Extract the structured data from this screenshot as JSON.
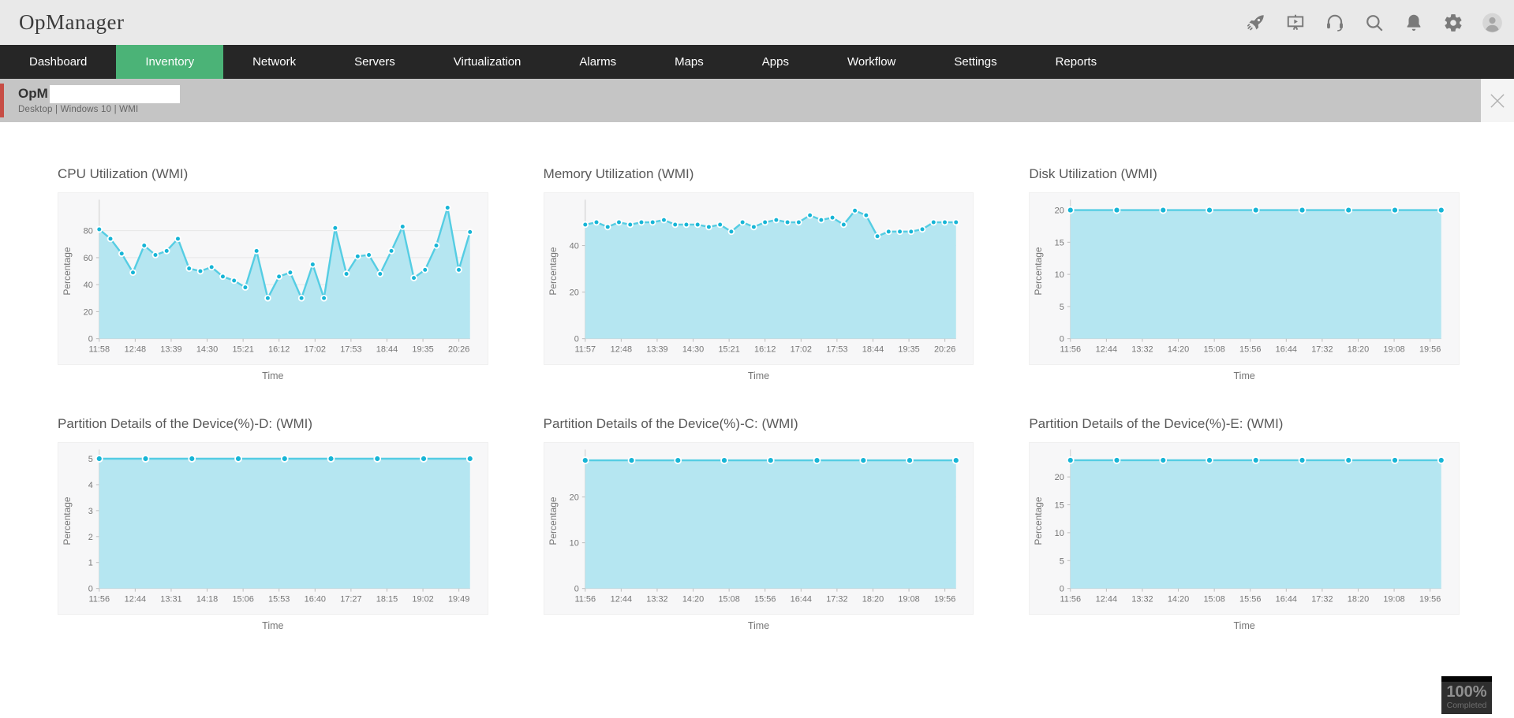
{
  "app": {
    "logo_text": "OpManager"
  },
  "topbar": {
    "icons": [
      "rocket",
      "presentation",
      "headset",
      "search",
      "notifications",
      "settings",
      "user-avatar"
    ]
  },
  "nav": {
    "items": [
      {
        "label": "Dashboard",
        "active": false
      },
      {
        "label": "Inventory",
        "active": true
      },
      {
        "label": "Network",
        "active": false
      },
      {
        "label": "Servers",
        "active": false
      },
      {
        "label": "Virtualization",
        "active": false
      },
      {
        "label": "Alarms",
        "active": false
      },
      {
        "label": "Maps",
        "active": false
      },
      {
        "label": "Apps",
        "active": false
      },
      {
        "label": "Workflow",
        "active": false
      },
      {
        "label": "Settings",
        "active": false
      },
      {
        "label": "Reports",
        "active": false
      }
    ]
  },
  "device_bar": {
    "name_visible": "OpM",
    "subtitle": "Desktop | Windows 10  | WMI"
  },
  "progress": {
    "percent": "100%",
    "label": "Completed"
  },
  "colors": {
    "accent_green": "#4bb377",
    "accent_red": "#c74d45",
    "area_fill": "#b5e6f1",
    "line": "#55cde3",
    "marker": "#17b5d6"
  },
  "chart_data": [
    {
      "id": "cpu",
      "type": "area",
      "title": "CPU Utilization (WMI)",
      "ylabel": "Percentage",
      "xlabel": "Time",
      "yticks": [
        0,
        20,
        40,
        60,
        80
      ],
      "ymax": 100,
      "xtick_labels": [
        "11:58",
        "12:48",
        "13:39",
        "14:30",
        "15:21",
        "16:12",
        "17:02",
        "17:53",
        "18:44",
        "19:35",
        "20:26"
      ],
      "values": [
        81,
        74,
        63,
        49,
        69,
        62,
        65,
        74,
        52,
        50,
        53,
        46,
        43,
        38,
        65,
        30,
        46,
        49,
        30,
        55,
        30,
        82,
        48,
        61,
        62,
        48,
        65,
        83,
        45,
        51,
        69,
        97,
        51,
        79
      ]
    },
    {
      "id": "memory",
      "type": "area",
      "title": "Memory Utilization (WMI)",
      "ylabel": "Percentage",
      "xlabel": "Time",
      "yticks": [
        0,
        20,
        40
      ],
      "ymax": 58,
      "xtick_labels": [
        "11:57",
        "12:48",
        "13:39",
        "14:30",
        "15:21",
        "16:12",
        "17:02",
        "17:53",
        "18:44",
        "19:35",
        "20:26"
      ],
      "values": [
        49,
        50,
        48,
        50,
        49,
        50,
        50,
        51,
        49,
        49,
        49,
        48,
        49,
        46,
        50,
        48,
        50,
        51,
        50,
        50,
        53,
        51,
        52,
        49,
        55,
        53,
        44,
        46,
        46,
        46,
        47,
        50,
        50,
        50
      ]
    },
    {
      "id": "disk",
      "type": "area",
      "title": "Disk Utilization (WMI)",
      "ylabel": "Percentage",
      "xlabel": "Time",
      "yticks": [
        0,
        5,
        10,
        15,
        20
      ],
      "ymax": 21,
      "xtick_labels": [
        "11:56",
        "12:44",
        "13:32",
        "14:20",
        "15:08",
        "15:56",
        "16:44",
        "17:32",
        "18:20",
        "19:08",
        "19:56"
      ],
      "values": [
        20,
        20,
        20,
        20,
        20,
        20,
        20,
        20,
        20
      ]
    },
    {
      "id": "partition-d",
      "type": "area",
      "title": "Partition Details of the Device(%)-D: (WMI)",
      "ylabel": "Percentage",
      "xlabel": "Time",
      "yticks": [
        0,
        1,
        2,
        3,
        4,
        5
      ],
      "ymax": 5.2,
      "xtick_labels": [
        "11:56",
        "12:44",
        "13:31",
        "14:18",
        "15:06",
        "15:53",
        "16:40",
        "17:27",
        "18:15",
        "19:02",
        "19:49"
      ],
      "values": [
        5,
        5,
        5,
        5,
        5,
        5,
        5,
        5,
        5
      ]
    },
    {
      "id": "partition-c",
      "type": "area",
      "title": "Partition Details of the Device(%)-C: (WMI)",
      "ylabel": "Percentage",
      "xlabel": "Time",
      "yticks": [
        0,
        10,
        20
      ],
      "ymax": 29.5,
      "xtick_labels": [
        "11:56",
        "12:44",
        "13:32",
        "14:20",
        "15:08",
        "15:56",
        "16:44",
        "17:32",
        "18:20",
        "19:08",
        "19:56"
      ],
      "values": [
        28,
        28,
        28,
        28,
        28,
        28,
        28,
        28,
        28
      ]
    },
    {
      "id": "partition-e",
      "type": "area",
      "title": "Partition Details of the Device(%)-E: (WMI)",
      "ylabel": "Percentage",
      "xlabel": "Time",
      "yticks": [
        0,
        5,
        10,
        15,
        20
      ],
      "ymax": 24.2,
      "xtick_labels": [
        "11:56",
        "12:44",
        "13:32",
        "14:20",
        "15:08",
        "15:56",
        "16:44",
        "17:32",
        "18:20",
        "19:08",
        "19:56"
      ],
      "values": [
        23,
        23,
        23,
        23,
        23,
        23,
        23,
        23,
        23
      ]
    }
  ]
}
